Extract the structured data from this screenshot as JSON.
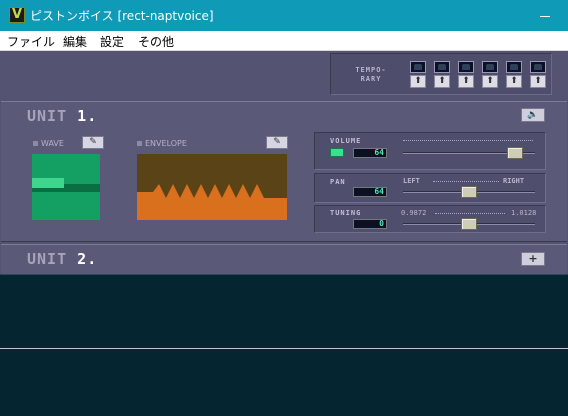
{
  "window": {
    "title": "ピストンボイス [rect-naptvoice]",
    "app_icon_letter": "V"
  },
  "menu": [
    "ファイル",
    "編集",
    "設定",
    "その他"
  ],
  "temporary": {
    "label_line1": "TEMPO-",
    "label_line2": "RARY",
    "slot_button_glyph": "⬆",
    "slot_count": 6
  },
  "unit1": {
    "title_word": "UNIT",
    "title_number": "1",
    "wave_label": "WAVE",
    "envelope_label": "ENVELOPE",
    "edit_glyph": "✎",
    "speaker_glyph": "🔈",
    "volume": {
      "label": "VOLUME",
      "value": "64",
      "level": 0.9
    },
    "pan": {
      "label": "PAN",
      "value": "64",
      "left_label": "LEFT",
      "right_label": "RIGHT",
      "level": 0.5
    },
    "tuning": {
      "label": "TUNING",
      "value": "0",
      "min_label": "0.9872",
      "max_label": "1.0128",
      "level": 0.5
    }
  },
  "unit2": {
    "title_word": "UNIT",
    "title_number": "2",
    "add_glyph": "+"
  },
  "colors": {
    "titlebar": "#0f9ab8",
    "panel": "#5a5977",
    "wave": "#13a062",
    "envelope_fill": "#d8701e",
    "value_text": "#56e2b8",
    "dark_area": "#052530"
  }
}
